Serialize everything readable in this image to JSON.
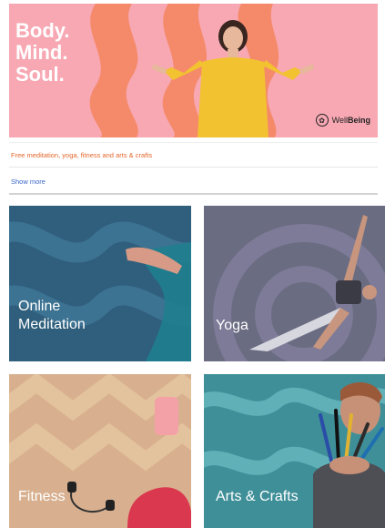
{
  "hero": {
    "title_lines": [
      "Body.",
      "Mind.",
      "Soul."
    ],
    "brand": {
      "icon": "lotus-icon",
      "name_regular": "Well",
      "name_bold": "Being"
    }
  },
  "tagline": "Free meditation, yoga, fitness and arts & crafts",
  "link": "Show more",
  "cards": [
    {
      "label_lines": [
        "Online",
        "Meditation"
      ],
      "overlay": "#2f5f7c"
    },
    {
      "label_lines": [
        "Yoga"
      ],
      "overlay": "#6a6c82"
    },
    {
      "label_lines": [
        "Fitness"
      ],
      "overlay": "#c58a78"
    },
    {
      "label_lines": [
        "Arts & Crafts"
      ],
      "overlay": "#3f8f99"
    }
  ],
  "colors": {
    "hero_bg": "#f7a8b3",
    "accent_orange": "#e4672c",
    "link_blue": "#3a67c9"
  }
}
